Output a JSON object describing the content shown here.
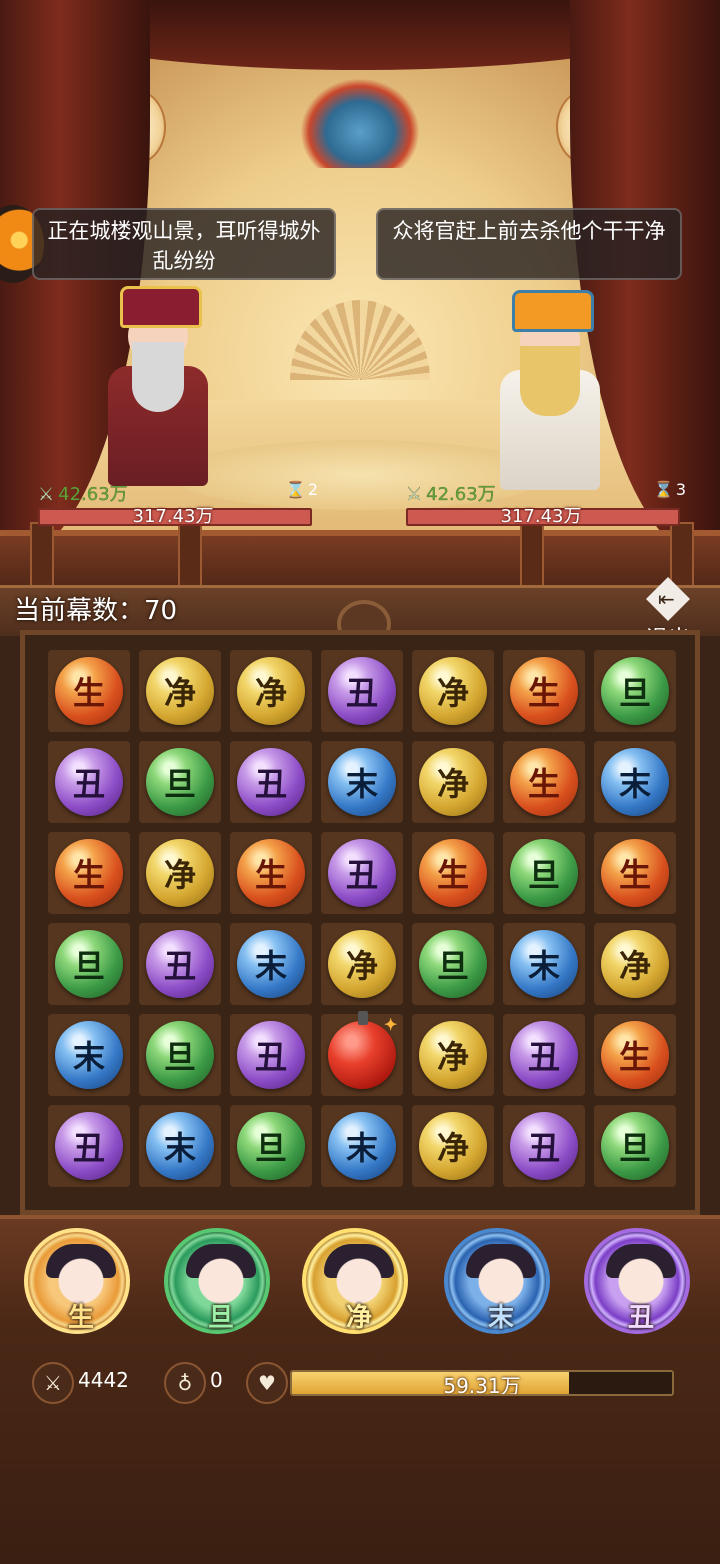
{
  "dialogue": {
    "left": "正在城楼观山景，耳听得城外乱纷纷",
    "right": "众将官赶上前去杀他个干干净"
  },
  "player_fighter": {
    "attack": "42.63万",
    "turns": "2",
    "hp": "317.43万"
  },
  "enemy_fighter": {
    "attack": "42.63万",
    "turns": "3",
    "hp": "317.43万"
  },
  "round": {
    "label": "当前幕数：",
    "value": "70"
  },
  "exit_label": "退出",
  "board": {
    "rows": [
      [
        "生",
        "净",
        "净",
        "丑",
        "净",
        "生",
        "旦"
      ],
      [
        "丑",
        "旦",
        "丑",
        "末",
        "净",
        "生",
        "末"
      ],
      [
        "生",
        "净",
        "生",
        "丑",
        "生",
        "旦",
        "生"
      ],
      [
        "旦",
        "丑",
        "末",
        "净",
        "旦",
        "末",
        "净"
      ],
      [
        "末",
        "旦",
        "丑",
        "bomb",
        "净",
        "丑",
        "生"
      ],
      [
        "丑",
        "末",
        "旦",
        "末",
        "净",
        "丑",
        "旦"
      ]
    ]
  },
  "heroes": [
    {
      "role": "生",
      "cls": "sheng"
    },
    {
      "role": "旦",
      "cls": "dan"
    },
    {
      "role": "净",
      "cls": "jing"
    },
    {
      "role": "末",
      "cls": "mo"
    },
    {
      "role": "丑",
      "cls": "chou"
    }
  ],
  "bottom_stats": {
    "attack_total": "4442",
    "gourd_count": "0",
    "hp_total": "59.31万",
    "hp_fill_fraction": 0.73
  },
  "icons": {
    "attack": "crossed-swords-icon",
    "turns": "hourglass-icon",
    "gourd": "gourd-icon",
    "heart": "heart-icon",
    "exit": "exit-door-icon"
  },
  "colors": {
    "sheng": "#d9501e",
    "jing": "#d4a630",
    "chou": "#8c4cc6",
    "dan": "#3c9a46",
    "mo": "#3578c6",
    "bomb": "#e8402c"
  }
}
